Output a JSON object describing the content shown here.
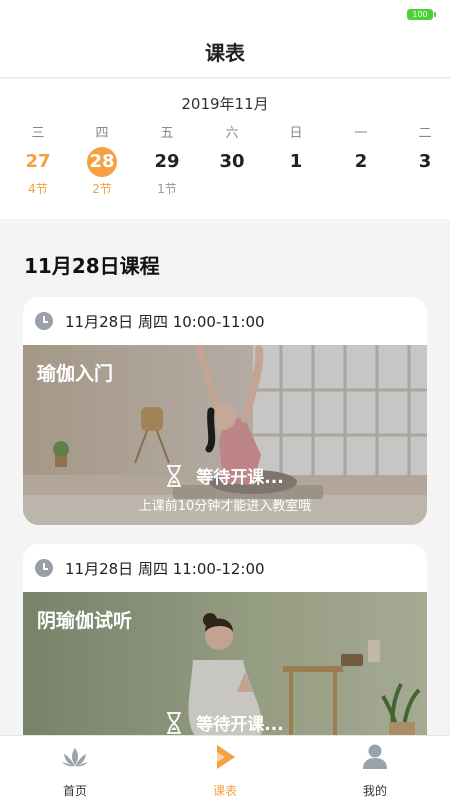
{
  "status_bar": {
    "battery": "100"
  },
  "header": {
    "title": "课表"
  },
  "calendar": {
    "month": "2019年11月",
    "days": [
      {
        "weekday": "三",
        "date": "27",
        "count": "4节"
      },
      {
        "weekday": "四",
        "date": "28",
        "count": "2节"
      },
      {
        "weekday": "五",
        "date": "29",
        "count": "1节"
      },
      {
        "weekday": "六",
        "date": "30",
        "count": ""
      },
      {
        "weekday": "日",
        "date": "1",
        "count": ""
      },
      {
        "weekday": "一",
        "date": "2",
        "count": ""
      },
      {
        "weekday": "二",
        "date": "3",
        "count": ""
      }
    ]
  },
  "section": {
    "title": "11月28日课程"
  },
  "courses": [
    {
      "time": "11月28日 周四 10:00-11:00",
      "name": "瑜伽入门",
      "status": "等待开课...",
      "hint": "上课前10分钟才能进入教室哦"
    },
    {
      "time": "11月28日 周四 11:00-12:00",
      "name": "阴瑜伽试听",
      "status": "等待开课..."
    }
  ],
  "tabbar": {
    "items": [
      {
        "label": "首页",
        "icon": "lotus-icon"
      },
      {
        "label": "课表",
        "icon": "play-icon"
      },
      {
        "label": "我的",
        "icon": "user-icon"
      }
    ]
  },
  "colors": {
    "accent": "#f5a142",
    "background": "#f4f4f4"
  }
}
